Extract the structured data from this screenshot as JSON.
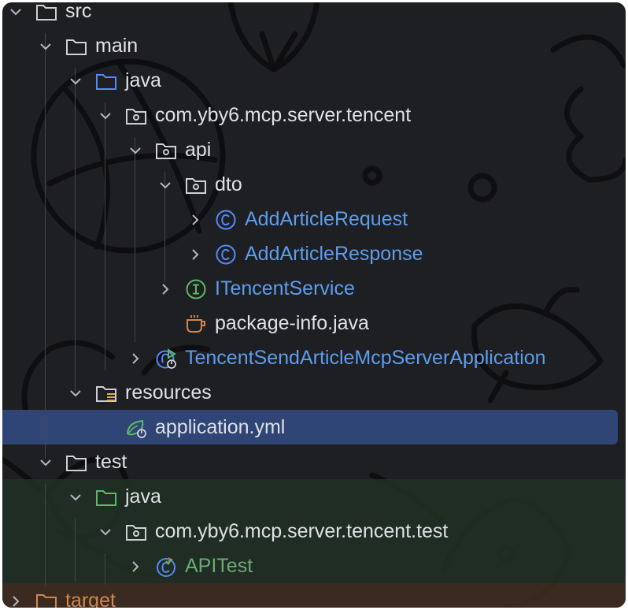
{
  "colors": {
    "background": "#1e1f22",
    "selection": "#2e436e",
    "test_band": "#1f2a22",
    "target_band": "#3a2a1f",
    "class_blue": "#5c9ded",
    "test_green": "#6aab73",
    "excluded_orange": "#d0874f",
    "default_text": "#dfe1e5"
  },
  "tree": [
    {
      "label": "src",
      "icon": "folder-icon",
      "expanded": true,
      "color": "default"
    },
    {
      "label": "main",
      "icon": "folder-icon",
      "expanded": true,
      "color": "default"
    },
    {
      "label": "java",
      "icon": "source-root-folder-icon",
      "expanded": true,
      "color": "default"
    },
    {
      "label": "com.yby6.mcp.server.tencent",
      "icon": "package-icon",
      "expanded": true,
      "color": "default"
    },
    {
      "label": "api",
      "icon": "package-icon",
      "expanded": true,
      "color": "default"
    },
    {
      "label": "dto",
      "icon": "package-icon",
      "expanded": true,
      "color": "default"
    },
    {
      "label": "AddArticleRequest",
      "icon": "class-icon",
      "expanded": false,
      "color": "blue"
    },
    {
      "label": "AddArticleResponse",
      "icon": "class-icon",
      "expanded": false,
      "color": "blue"
    },
    {
      "label": "ITencentService",
      "icon": "interface-icon",
      "expanded": false,
      "color": "blue"
    },
    {
      "label": "package-info.java",
      "icon": "java-file-icon",
      "color": "default"
    },
    {
      "label": "TencentSendArticleMcpServerApplication",
      "icon": "spring-boot-class-icon",
      "expanded": false,
      "color": "blue"
    },
    {
      "label": "resources",
      "icon": "resources-folder-icon",
      "expanded": true,
      "color": "default"
    },
    {
      "label": "application.yml",
      "icon": "spring-config-icon",
      "color": "default",
      "selected": true
    },
    {
      "label": "test",
      "icon": "folder-icon",
      "expanded": true,
      "color": "default"
    },
    {
      "label": "java",
      "icon": "test-root-folder-icon",
      "expanded": true,
      "color": "default"
    },
    {
      "label": "com.yby6.mcp.server.tencent.test",
      "icon": "package-icon",
      "expanded": true,
      "color": "default"
    },
    {
      "label": "APITest",
      "icon": "test-class-icon",
      "expanded": false,
      "color": "green"
    },
    {
      "label": "target",
      "icon": "excluded-folder-icon",
      "expanded": false,
      "color": "orange"
    }
  ]
}
